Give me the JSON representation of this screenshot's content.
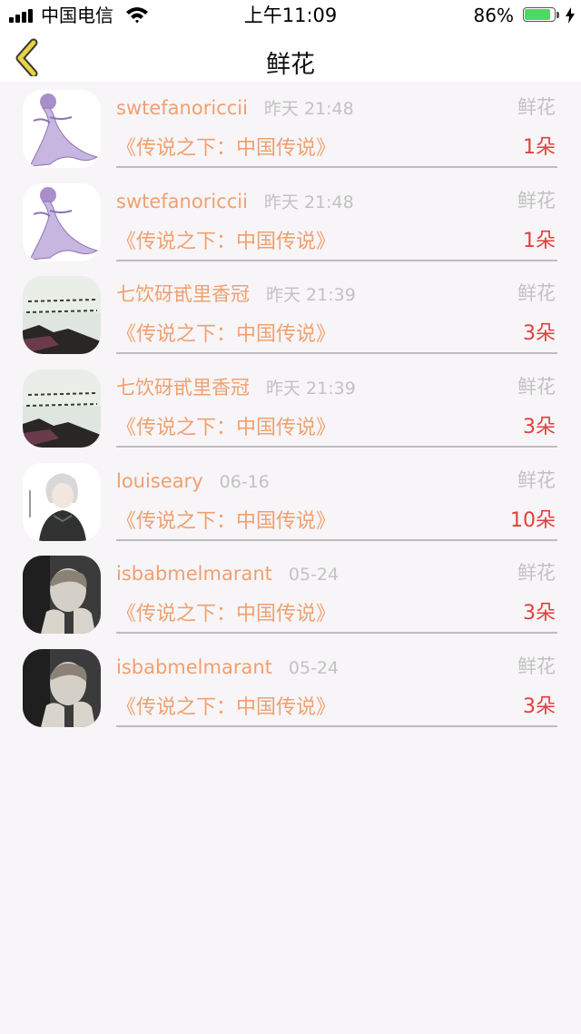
{
  "status_bar": {
    "carrier": "中国电信",
    "time": "上午11:09",
    "battery_percent": "86%",
    "battery_level": 0.86,
    "icons": [
      "signal-icon",
      "wifi-icon",
      "battery-icon",
      "charging-bolt-icon"
    ]
  },
  "nav": {
    "title": "鲜花",
    "back_icon": "chevron-left-icon"
  },
  "colors": {
    "accent": "#f0a070",
    "count": "#e0403c",
    "muted": "#c2c2c2",
    "back_icon": "#e8d24a",
    "battery": "#4cd964"
  },
  "items": [
    {
      "username": "swtefanoriccii",
      "time": "昨天 21:48",
      "category": "鲜花",
      "book": "《传说之下：中国传说》",
      "count": "1朵",
      "avatar": "gardevoir"
    },
    {
      "username": "swtefanoriccii",
      "time": "昨天 21:48",
      "category": "鲜花",
      "book": "《传说之下：中国传说》",
      "count": "1朵",
      "avatar": "gardevoir"
    },
    {
      "username": "七饮砑甙里香冠",
      "time": "昨天 21:39",
      "category": "鲜花",
      "book": "《传说之下：中国传说》",
      "count": "3朵",
      "avatar": "landscape"
    },
    {
      "username": "七饮砑甙里香冠",
      "time": "昨天 21:39",
      "category": "鲜花",
      "book": "《传说之下：中国传说》",
      "count": "3朵",
      "avatar": "landscape"
    },
    {
      "username": "louiseary",
      "time": "06-16",
      "category": "鲜花",
      "book": "《传说之下：中国传说》",
      "count": "10朵",
      "avatar": "anime"
    },
    {
      "username": "isbabmelmarant",
      "time": "05-24",
      "category": "鲜花",
      "book": "《传说之下：中国传说》",
      "count": "3朵",
      "avatar": "child"
    },
    {
      "username": "isbabmelmarant",
      "time": "05-24",
      "category": "鲜花",
      "book": "《传说之下：中国传说》",
      "count": "3朵",
      "avatar": "child"
    }
  ]
}
